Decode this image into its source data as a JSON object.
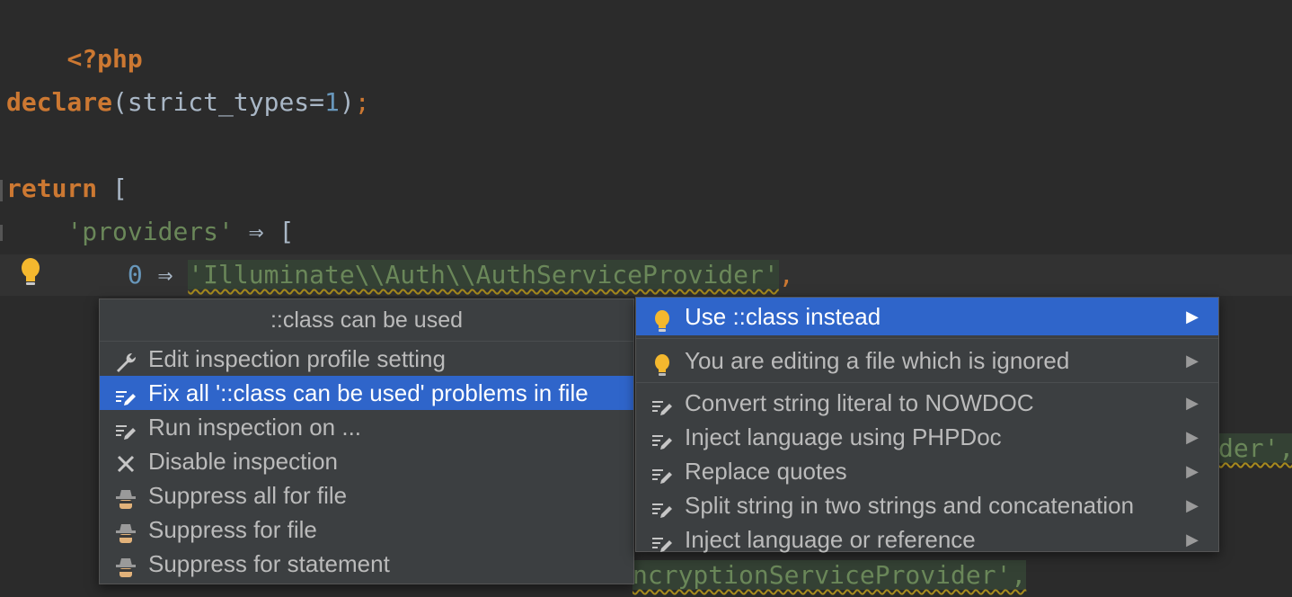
{
  "code": {
    "php_open": "<?php",
    "declare_kw": "declare",
    "declare_args_pre": "(strict_types=",
    "declare_num": "1",
    "declare_close": ")",
    "declare_semi": ";",
    "return_kw": "return",
    "return_bracket": " [",
    "providers_indent": "    ",
    "providers_key": "'providers'",
    "providers_arrow": " ⇒ [",
    "line5_indent": "        ",
    "line5_index": "0",
    "line5_arrow": " ⇒ ",
    "line5_string": "'Illuminate\\\\Auth\\\\AuthServiceProvider'",
    "line5_comma": ",",
    "peek_right": "der',",
    "peek_bottom": "ncryptionServiceProvider',"
  },
  "inspection_popup": {
    "title": "::class can be used",
    "items": [
      {
        "label": "Edit inspection profile setting",
        "icon": "wrench-icon"
      },
      {
        "label": "Fix all '::class can be used' problems in file",
        "icon": "quickfix-icon"
      },
      {
        "label": "Run inspection on ...",
        "icon": "quickfix-icon"
      },
      {
        "label": "Disable inspection",
        "icon": "close-icon"
      },
      {
        "label": "Suppress all for file",
        "icon": "suppress-icon"
      },
      {
        "label": "Suppress for file",
        "icon": "suppress-icon"
      },
      {
        "label": "Suppress for statement",
        "icon": "suppress-icon"
      }
    ],
    "selected_index": 1
  },
  "intention_popup": {
    "items": [
      {
        "label": "Use ::class instead",
        "icon": "lightbulb-icon",
        "has_submenu": true
      },
      {
        "label": "You are editing a file which is ignored",
        "icon": "lightbulb-icon",
        "has_submenu": true
      },
      {
        "label": "Convert string literal to NOWDOC",
        "icon": "quickfix-icon",
        "has_submenu": true
      },
      {
        "label": "Inject language using PHPDoc",
        "icon": "quickfix-icon",
        "has_submenu": true
      },
      {
        "label": "Replace quotes",
        "icon": "quickfix-icon",
        "has_submenu": true
      },
      {
        "label": "Split string in two strings and concatenation",
        "icon": "quickfix-icon",
        "has_submenu": true
      },
      {
        "label": "Inject language or reference",
        "icon": "quickfix-icon",
        "has_submenu": true
      }
    ],
    "selected_index": 0,
    "submenu_arrow": "▶"
  },
  "colors": {
    "background": "#2b2b2b",
    "keyword": "#cc7832",
    "string": "#6a8759",
    "number": "#6897bb",
    "selection": "#2f65ca",
    "bulb": "#f4b82e"
  }
}
